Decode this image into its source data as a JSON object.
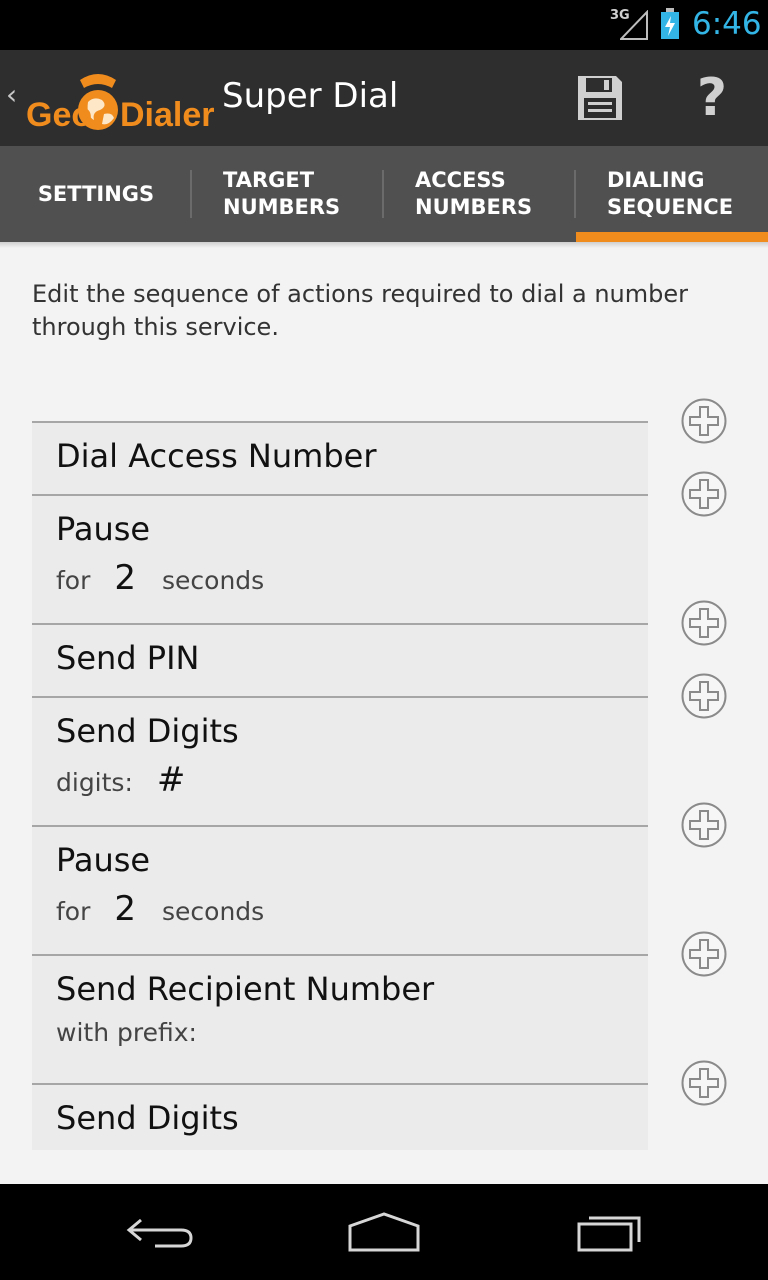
{
  "status_bar": {
    "network": "3G",
    "time": "6:46",
    "time_color": "#33b5e5"
  },
  "action_bar": {
    "logo_left": "Geo",
    "logo_right": "Dialer",
    "title": "Super Dial",
    "help_label": "?",
    "icons": [
      "up-caret-icon",
      "globe-phone-icon",
      "save-icon",
      "help-icon"
    ]
  },
  "tabs": [
    {
      "label": "SETTINGS",
      "selected": false
    },
    {
      "label": "TARGET NUMBERS",
      "selected": false
    },
    {
      "label": "ACCESS NUMBERS",
      "selected": false
    },
    {
      "label": "DIALING SEQUENCE",
      "selected": true
    }
  ],
  "accent_color": "#f08c1e",
  "description": "Edit the sequence of actions required to dial a number through this service.",
  "sequence": [
    {
      "title": "Dial Access Number"
    },
    {
      "title": "Pause",
      "sub_prefix": "for",
      "sub_value": "2",
      "sub_suffix": "seconds"
    },
    {
      "title": "Send PIN"
    },
    {
      "title": "Send Digits",
      "sub_prefix": "digits:",
      "sub_value": "#"
    },
    {
      "title": "Pause",
      "sub_prefix": "for",
      "sub_value": "2",
      "sub_suffix": "seconds"
    },
    {
      "title": "Send Recipient Number",
      "sub_prefix": "with prefix:"
    },
    {
      "title": "Send Digits"
    }
  ],
  "nav_bar": {
    "icons": [
      "back-icon",
      "home-icon",
      "recent-apps-icon"
    ]
  }
}
